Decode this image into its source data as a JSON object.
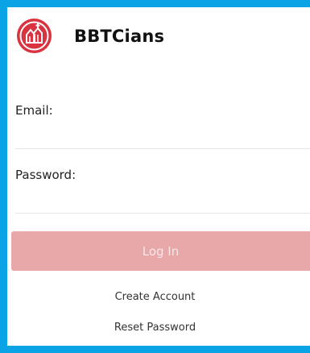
{
  "header": {
    "logo_icon": "church-cross-logo-icon",
    "app_title": "BBTCians"
  },
  "form": {
    "email_label": "Email:",
    "email_value": "",
    "password_label": "Password:",
    "password_value": "",
    "login_label": "Log In"
  },
  "links": {
    "create_account": "Create Account",
    "reset_password": "Reset Password"
  },
  "colors": {
    "frame_border": "#0aa4e6",
    "brand_red": "#d8333f",
    "login_button_bg": "#e8a8aa"
  }
}
